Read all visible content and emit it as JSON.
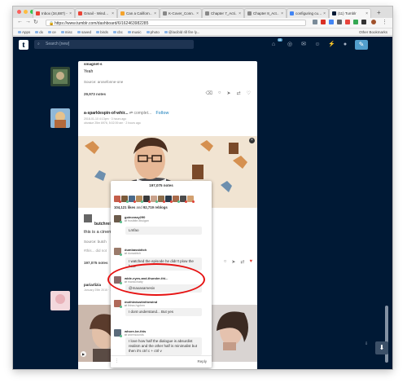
{
  "browser": {
    "tabs": [
      {
        "title": "Inbox (34,887) - …",
        "color": "#ea4335",
        "active": false
      },
      {
        "title": "Gmail - Wind…",
        "color": "#ea4335",
        "active": false
      },
      {
        "title": "Can a Californ…",
        "color": "#f4a32c",
        "active": false
      },
      {
        "title": "K-Cover_Conn…",
        "color": "#888888",
        "active": false
      },
      {
        "title": "Chapter 7_Acti…",
        "color": "#888888",
        "active": false
      },
      {
        "title": "Chapter 8_Act…",
        "color": "#888888",
        "active": false
      },
      {
        "title": "configuring cu…",
        "color": "#4285f4",
        "active": false
      },
      {
        "title": "(11) Tumblr",
        "color": "#001935",
        "active": true
      }
    ],
    "url": "https://www.tumblr.com/dashboard/6/162463982285",
    "bookmarks": [
      "Apps",
      "dx",
      "ce",
      "misc",
      "saved",
      "birds",
      "cbc",
      "music",
      "photo",
      "@lacibld rill fire ly..."
    ],
    "other_bookmarks": "Other Bookmarks"
  },
  "tumblr": {
    "search_placeholder": "Search [new]",
    "inbox_badge": "11",
    "post1": {
      "blog": "smagnet-s",
      "text": "Yeah",
      "source": "Source: arosefonne-one",
      "notes": "29,973 notes"
    },
    "post2": {
      "blog": "a-sparklespin-of-whir...",
      "rebloggedfrom": "complet...",
      "follow": "Follow",
      "meta_line1": "2018-01-10  4:13pm · 3 hours ago",
      "meta_line2": "obvalue 25m 6976, 5:02:39 am · 2 hours ago",
      "blog2": "butchrei",
      "text": "this is a cinem",
      "source": "Source: butch",
      "tags": "#this...  did not",
      "notes": "197,075 notes"
    },
    "post3": {
      "blog": "pariarlizia",
      "meta": "January 25th 2015 · ..."
    }
  },
  "notes_popup": {
    "title": "197,075 notes",
    "likes": "104,121 likes",
    "and": "and",
    "reblogs": "92,719 reblogs",
    "notes": [
      {
        "name": "goincrazy290",
        "from": "frostbite-fibulgan",
        "text": "Lmfao"
      },
      {
        "name": "dumbassbitch",
        "from": "dunsabtch",
        "text": "I watched the episode he didn't plow the bear"
      },
      {
        "name": "wide-eyes-and-thunder-thi...",
        "from": "manicchatty",
        "text": "@maxasamesiv"
      },
      {
        "name": "mothiedustinthewind",
        "from": "thirza-hyphen",
        "text": "I dont understand... But yes"
      },
      {
        "name": "whore-be-this",
        "from": "wormsounds",
        "text": "I love how half the dialogue is absurdist realism and the other half is minimalist but then it's  ctrl c + ctrl v"
      }
    ],
    "reply": "Reply"
  }
}
